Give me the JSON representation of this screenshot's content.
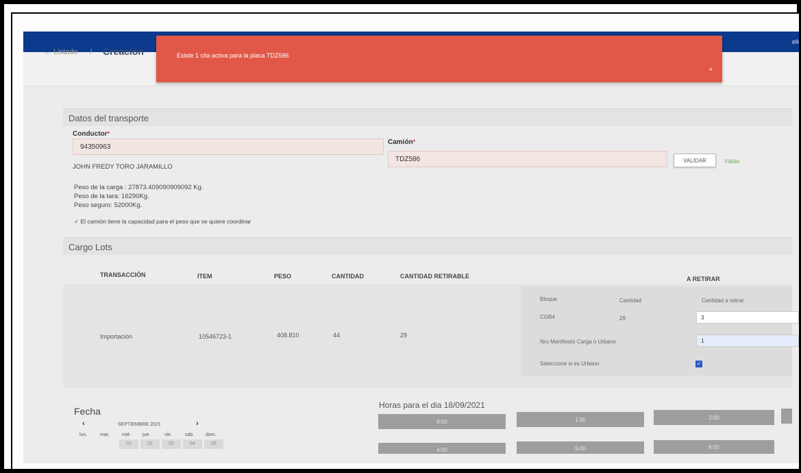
{
  "topbar": {
    "user_text": "ello"
  },
  "breadcrumb": {
    "back_label": "← Listado",
    "separator": "/",
    "current": "Creacion"
  },
  "alert": {
    "message": "Existe 1 cita activa para la placa TDZ586",
    "close": "×"
  },
  "transport": {
    "section_title": "Datos del transporte",
    "conductor_label": "Conductor",
    "conductor_value": "94350963",
    "conductor_name": "JOHN FREDY TORO JARAMILLO",
    "camion_label": "Camión",
    "camion_value": "TDZ586",
    "validate_button": "VALIDAR",
    "validate_status": "Válido",
    "peso_carga": "Peso de la carga : 27873.409090909092 Kg.",
    "peso_tara": "Peso de la tara: 16290Kg.",
    "peso_seguro": "Peso seguro: 52000Kg.",
    "capacity_msg": "✓ El camión tiene la capacidad para el peso que se quiere coordinar"
  },
  "cargo": {
    "section_title": "Cargo Lots",
    "headers": [
      "TRANSACCIÓN",
      "ITEM",
      "PESO",
      "CANTIDAD",
      "CANTIDAD RETIRABLE",
      "A RETIRAR"
    ],
    "row": {
      "transaccion": "Importacion",
      "item": "10546723-1",
      "peso": "408.810",
      "cantidad": "44",
      "cantidad_retirable": "29"
    },
    "panel": {
      "bloque_label": "Bloque",
      "cantidad_label": "Cantidad",
      "cantidad_retirar_label": "Cantidad a retirar",
      "bloque_value": "CGB4",
      "cantidad_value": "29",
      "cantidad_retirar_value": "3",
      "manifiesto_label": "Nro Manifiesto Carga o Urbano",
      "manifiesto_value": "1",
      "urbano_label": "Seleccione si es Urbano",
      "urbano_checked": true
    }
  },
  "calendar": {
    "title": "Fecha",
    "prev": "‹",
    "next": "›",
    "month": "SEPTIEMBRE 2021",
    "weekdays": [
      "lun.",
      "mar.",
      "mié.",
      "jue.",
      "vie.",
      "sáb.",
      "dom."
    ],
    "days": [
      "01",
      "02",
      "03",
      "04",
      "05"
    ]
  },
  "hours": {
    "title": "Horas para el dia 18/09/2021",
    "slots": [
      "0:00",
      "1:00",
      "2:00",
      "4:00",
      "5:00",
      "6:00"
    ]
  }
}
